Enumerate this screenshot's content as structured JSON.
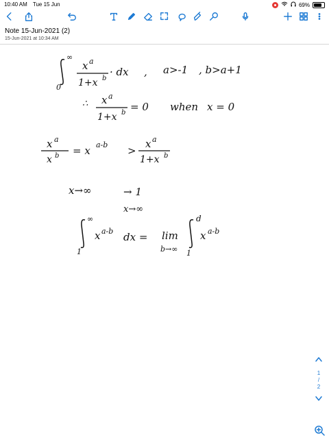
{
  "status": {
    "time": "10:40 AM",
    "date": "Tue 15 Jun",
    "battery": "69%",
    "battery_level": 0.69
  },
  "note": {
    "title": "Note 15-Jun-2021 (2)",
    "created": "15-Jun-2021 at 10:34 AM"
  },
  "pages": {
    "current": "1",
    "separator": "/",
    "total": "2"
  },
  "toolbar_icons": [
    "back-icon",
    "share-icon",
    "undo-icon",
    "text-tool-icon",
    "pen-icon",
    "eraser-icon",
    "lasso-icon",
    "shapes-icon",
    "highlighter-icon",
    "microphone-icon",
    "add-page-icon",
    "grid-icon",
    "more-icon"
  ],
  "math": {
    "int_upper": "∞",
    "int_lower": "0",
    "frac1_num": "x",
    "frac1_num_exp": "a",
    "frac1_den": "1+x",
    "frac1_den_exp": "b",
    "dx": "· dx",
    "comma": ",",
    "cond1": "a>-1",
    "cond2": ", b>a+1",
    "therefore": "∴",
    "frac2_num": "x",
    "frac2_num_exp": "a",
    "frac2_den": "1+x",
    "frac2_den_exp": "b",
    "eq_zero": "= 0",
    "when": "when",
    "x_eq_zero": "x = 0",
    "frac3_num": "x",
    "frac3_num_exp": "a",
    "frac3_den": "x",
    "frac3_den_exp": "b",
    "eq_x": "= x",
    "exp_ab": "a-b",
    "gt": ">",
    "frac4_num": "x",
    "frac4_num_exp": "a",
    "frac4_den": "1+x",
    "frac4_den_exp": "b",
    "x_to_inf": "x→∞",
    "arrow_one": "→ 1",
    "x_to_inf2": "x→∞",
    "int2_upper": "∞",
    "int2_lower": "1",
    "x2": "x",
    "x2_exp": "a-b",
    "dx2": "dx =",
    "lim": "lim",
    "lim_sub": "b→∞",
    "int3_upper": "d",
    "int3_lower": "1",
    "x3": "x",
    "x3_exp": "a-b"
  }
}
